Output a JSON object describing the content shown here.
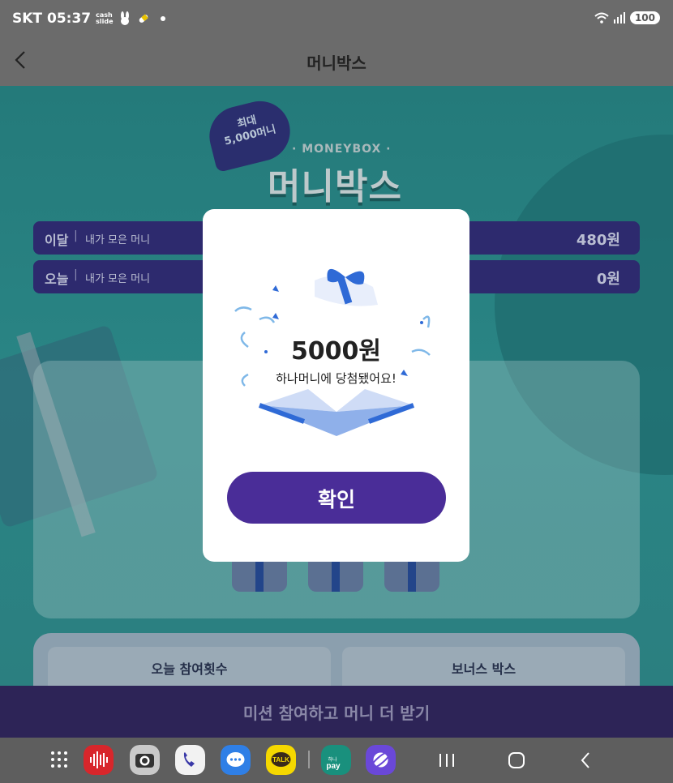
{
  "status_bar": {
    "carrier": "SKT",
    "time": "05:37",
    "cashslide_top": "cash",
    "cashslide_bottom": "slide",
    "battery": "100",
    "icons": [
      "rabbit-icon",
      "pill-icon",
      "wifi-icon",
      "signal-icon"
    ]
  },
  "header": {
    "title": "머니박스",
    "back_icon": "chevron-left-icon"
  },
  "banner": {
    "badge_line1": "최대",
    "badge_line2": "5,000머니",
    "brand_sub": "· MONEYBOX ·",
    "brand_title": "머니박스"
  },
  "money_rows": [
    {
      "label": "이달",
      "separator": "|",
      "sub": "내가 모은 머니",
      "amount": "480원"
    },
    {
      "label": "오늘",
      "separator": "|",
      "sub": "내가 모은 머니",
      "amount": "0원"
    }
  ],
  "bottom_cards": {
    "today_count": "오늘 참여횟수",
    "bonus_box": "보너스 박스"
  },
  "mission_bar": {
    "label": "미션 참여하고 머니 더 받기"
  },
  "modal": {
    "amount": "5000원",
    "message": "하나머니에 당첨됐어요!",
    "confirm_label": "확인"
  },
  "dock": {
    "apps": [
      "apps-grid-icon",
      "voice-recorder-icon",
      "camera-icon",
      "phone-icon",
      "messages-icon",
      "kakaotalk-icon",
      "hana-pay-icon",
      "browser-icon"
    ],
    "kakao_label": "TALK",
    "hana_label_top": "하나",
    "hana_label_bottom": "pay"
  },
  "colors": {
    "accent_purple": "#4a2d98",
    "teal_bg": "#2a8585",
    "navy_row": "#2d2a6e"
  }
}
